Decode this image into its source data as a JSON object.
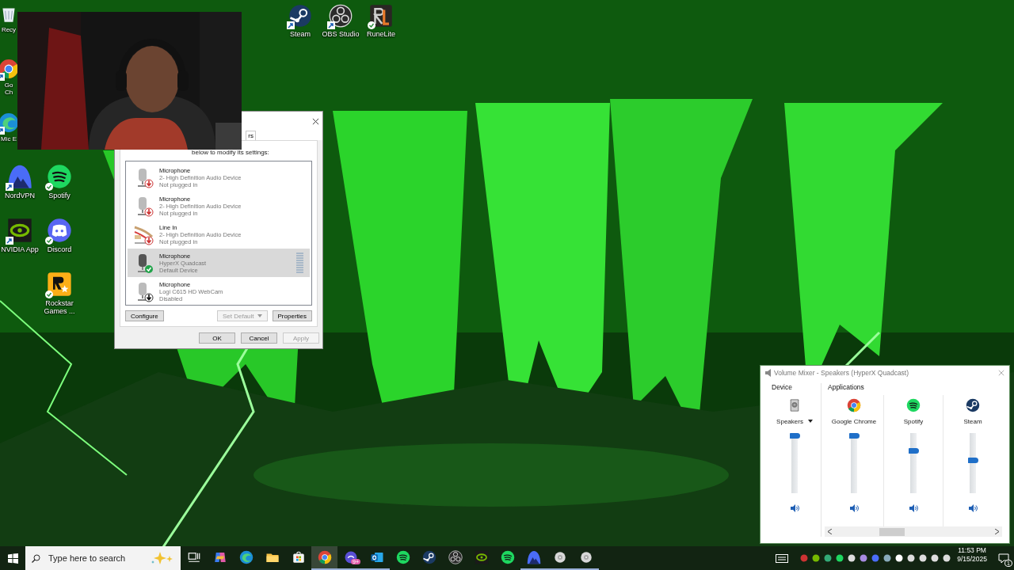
{
  "desktop_icons": [
    {
      "label": "Recy",
      "kind": "recycle-bin",
      "shortcut": false,
      "synced": false
    },
    {
      "label": "Go Ch",
      "kind": "chrome",
      "shortcut": true,
      "synced": false
    },
    {
      "label": "Mic E",
      "kind": "edge",
      "shortcut": true,
      "synced": false
    },
    {
      "label": "NordVPN",
      "kind": "nordvpn",
      "shortcut": true,
      "synced": false
    },
    {
      "label": "Spotify",
      "kind": "spotify",
      "shortcut": false,
      "synced": true
    },
    {
      "label": "NVIDIA App",
      "kind": "nvidia",
      "shortcut": true,
      "synced": false
    },
    {
      "label": "Discord",
      "kind": "discord",
      "shortcut": false,
      "synced": true
    },
    {
      "label": "Rockstar Games ...",
      "kind": "rockstar",
      "shortcut": false,
      "synced": true
    },
    {
      "label": "Steam",
      "kind": "steam",
      "shortcut": true,
      "synced": false
    },
    {
      "label": "OBS Studio",
      "kind": "obs",
      "shortcut": true,
      "synced": false
    },
    {
      "label": "RuneLite",
      "kind": "runelite",
      "shortcut": false,
      "synced": true
    }
  ],
  "sound_dialog": {
    "tab": "rs",
    "instruction": "below to modify its settings:",
    "devices": [
      {
        "name": "Microphone",
        "device": "2- High Definition Audio Device",
        "status": "Not plugged in",
        "kind": "microphone",
        "unplugged": true,
        "default": false,
        "disabled": false,
        "selected": false
      },
      {
        "name": "Microphone",
        "device": "2- High Definition Audio Device",
        "status": "Not plugged in",
        "kind": "microphone",
        "unplugged": true,
        "default": false,
        "disabled": false,
        "selected": false
      },
      {
        "name": "Line In",
        "device": "2- High Definition Audio Device",
        "status": "Not plugged in",
        "kind": "line-in",
        "unplugged": true,
        "default": false,
        "disabled": false,
        "selected": false
      },
      {
        "name": "Microphone",
        "device": "HyperX Quadcast",
        "status": "Default Device",
        "kind": "microphone",
        "unplugged": false,
        "default": true,
        "disabled": false,
        "selected": true
      },
      {
        "name": "Microphone",
        "device": "Logi C615 HD WebCam",
        "status": "Disabled",
        "kind": "microphone",
        "unplugged": false,
        "default": false,
        "disabled": true,
        "selected": false
      }
    ],
    "buttons": [
      {
        "label": "Configure",
        "disabled": false,
        "kind": "plain"
      },
      {
        "label": "Set Default",
        "disabled": true,
        "kind": "split"
      },
      {
        "label": "Properties",
        "disabled": false,
        "kind": "plain"
      }
    ],
    "footer_buttons": [
      {
        "label": "OK",
        "disabled": false
      },
      {
        "label": "Cancel",
        "disabled": false
      },
      {
        "label": "Apply",
        "disabled": true
      }
    ]
  },
  "volume_mixer": {
    "title": "Volume Mixer - Speakers (HyperX Quadcast)",
    "device_heading": "Device",
    "applications_heading": "Applications",
    "channels": [
      {
        "name": "Speakers",
        "kind": "device",
        "level": 1,
        "muted": false
      },
      {
        "name": "Google Chrome",
        "kind": "chrome",
        "level": 1,
        "muted": false
      },
      {
        "name": "Spotify",
        "kind": "spotify",
        "level": 0.72,
        "muted": false
      },
      {
        "name": "Steam",
        "kind": "steam",
        "level": 0.55,
        "muted": false
      }
    ]
  },
  "taskbar": {
    "search": {
      "placeholder": "Type here to search"
    },
    "apps": [
      {
        "kind": "task-view",
        "running": false,
        "selected": false
      },
      {
        "kind": "copilot",
        "running": false,
        "selected": false
      },
      {
        "kind": "edge",
        "running": false,
        "selected": false
      },
      {
        "kind": "explorer",
        "running": false,
        "selected": false
      },
      {
        "kind": "store",
        "running": false,
        "selected": false
      },
      {
        "kind": "chrome",
        "running": true,
        "selected": true
      },
      {
        "kind": "chat",
        "running": true,
        "selected": false,
        "badge": "9+"
      },
      {
        "kind": "outlook",
        "running": true,
        "selected": false
      },
      {
        "kind": "spotify",
        "running": false,
        "selected": false
      },
      {
        "kind": "steam",
        "running": false,
        "selected": false
      },
      {
        "kind": "obs",
        "running": false,
        "selected": false
      },
      {
        "kind": "nvidia",
        "running": false,
        "selected": false
      },
      {
        "kind": "spotify",
        "running": false,
        "selected": false
      },
      {
        "kind": "nordvpn",
        "running": true,
        "selected": false
      },
      {
        "kind": "disc",
        "running": true,
        "selected": false
      },
      {
        "kind": "disc",
        "running": true,
        "selected": false
      }
    ],
    "time": "11:53 PM",
    "date": "9/15/2025",
    "notifications": "1"
  }
}
